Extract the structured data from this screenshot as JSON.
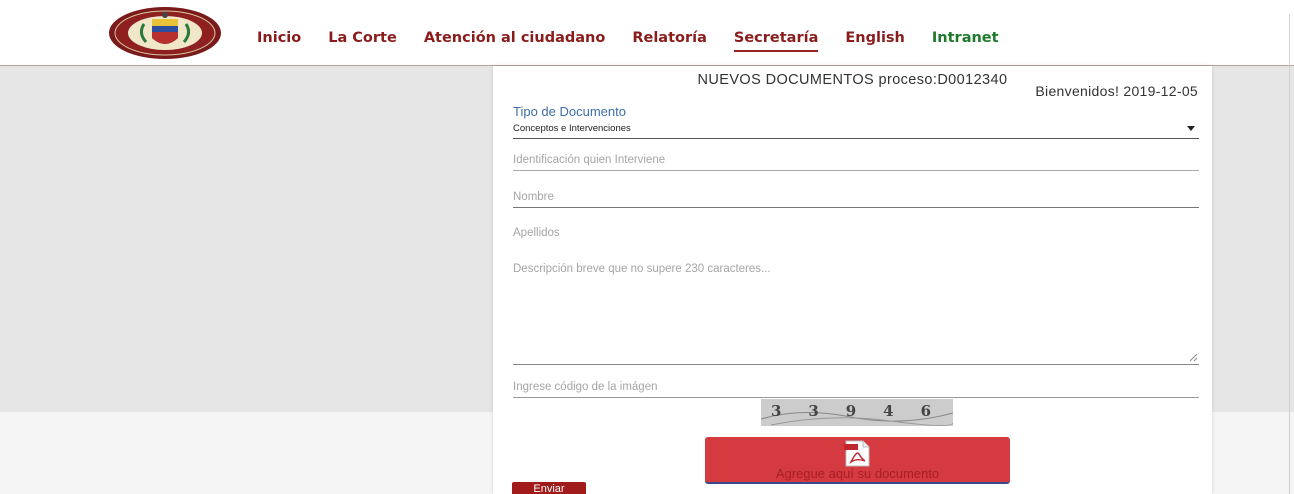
{
  "header": {
    "logo_icon": "colombia-coat-of-arms-seal",
    "nav": [
      {
        "label": "Inicio",
        "color": "#8a1c1c"
      },
      {
        "label": "La Corte",
        "color": "#8a1c1c"
      },
      {
        "label": "Atención al ciudadano",
        "color": "#8a1c1c"
      },
      {
        "label": "Relatoría",
        "color": "#8a1c1c"
      },
      {
        "label": "Secretaría",
        "color": "#8a1c1c",
        "active": true
      },
      {
        "label": "English",
        "color": "#8a1c1c"
      },
      {
        "label": "Intranet",
        "color": "#1d7a2a"
      }
    ]
  },
  "form": {
    "title": "NUEVOS DOCUMENTOS proceso:D0012340",
    "welcome": "Bienvenidos! 2019-12-05",
    "doc_type_label": "Tipo de Documento",
    "doc_type_value": "Conceptos e Intervenciones",
    "id_placeholder": "Identificación quien Interviene",
    "name_placeholder": "Nombre",
    "surname_placeholder": "Apellidos",
    "description_placeholder": "Descripción breve que no supere 230 caracteres...",
    "captcha_placeholder": "Ingrese código de la imágen",
    "captcha_text": "3 3 9 4 6",
    "upload_label": "Agregue aquí su documento",
    "upload_icon": "pdf-file-icon",
    "submit_label": "Enviar",
    "accent_color": "#d43a3f"
  }
}
